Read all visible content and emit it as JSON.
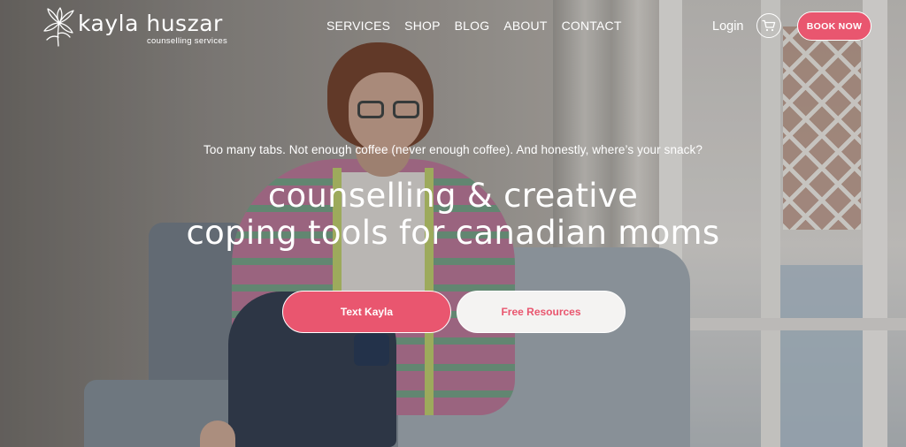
{
  "brand": {
    "name": "kayla huszar",
    "subtitle": "counselling services"
  },
  "nav": {
    "items": [
      "SERVICES",
      "SHOP",
      "BLOG",
      "ABOUT",
      "CONTACT"
    ],
    "login_label": "Login",
    "cart_icon": "shopping-cart-icon",
    "book_label": "BOOK NOW"
  },
  "hero": {
    "tagline": "Too many tabs. Not enough coffee (never enough coffee). And honestly, where’s your snack?",
    "headline_line1": "counselling & creative",
    "headline_line2": "coping tools for canadian moms",
    "primary_button": "Text Kayla",
    "secondary_button": "Free Resources"
  },
  "colors": {
    "accent": "#e9566f",
    "text_light": "#ffffff",
    "button_light": "#f4f3f2"
  }
}
